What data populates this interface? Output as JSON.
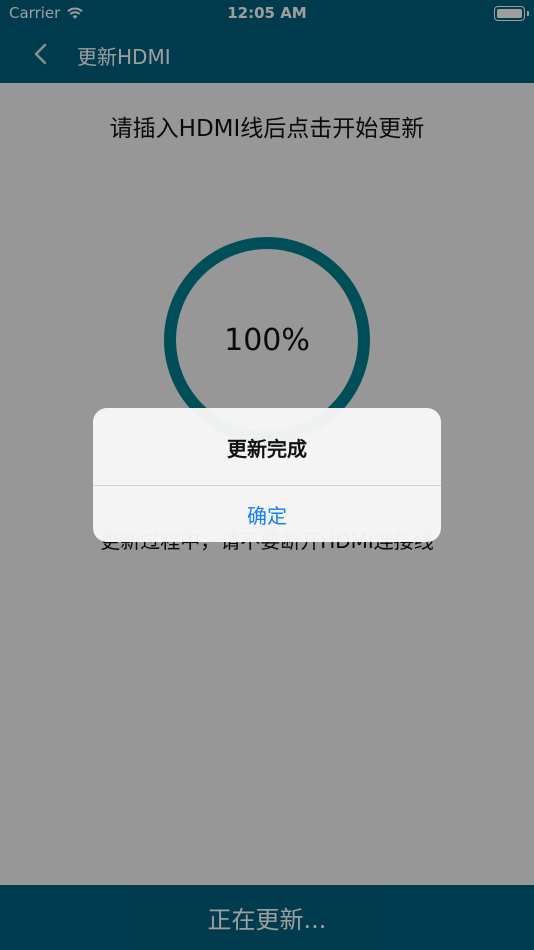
{
  "status_bar": {
    "carrier": "Carrier",
    "time": "12:05 AM"
  },
  "nav": {
    "title": "更新HDMI"
  },
  "main": {
    "instruction": "请插入HDMI线后点击开始更新",
    "progress_label": "100%",
    "progress": 1.0,
    "warning": "更新过程中，请不要断开HDMI连接线"
  },
  "bottom": {
    "label": "正在更新..."
  },
  "alert": {
    "title": "更新完成",
    "confirm_label": "确定"
  },
  "colors": {
    "nav": "#00617f",
    "ring": "#00808f",
    "alert_button": "#147efb"
  }
}
